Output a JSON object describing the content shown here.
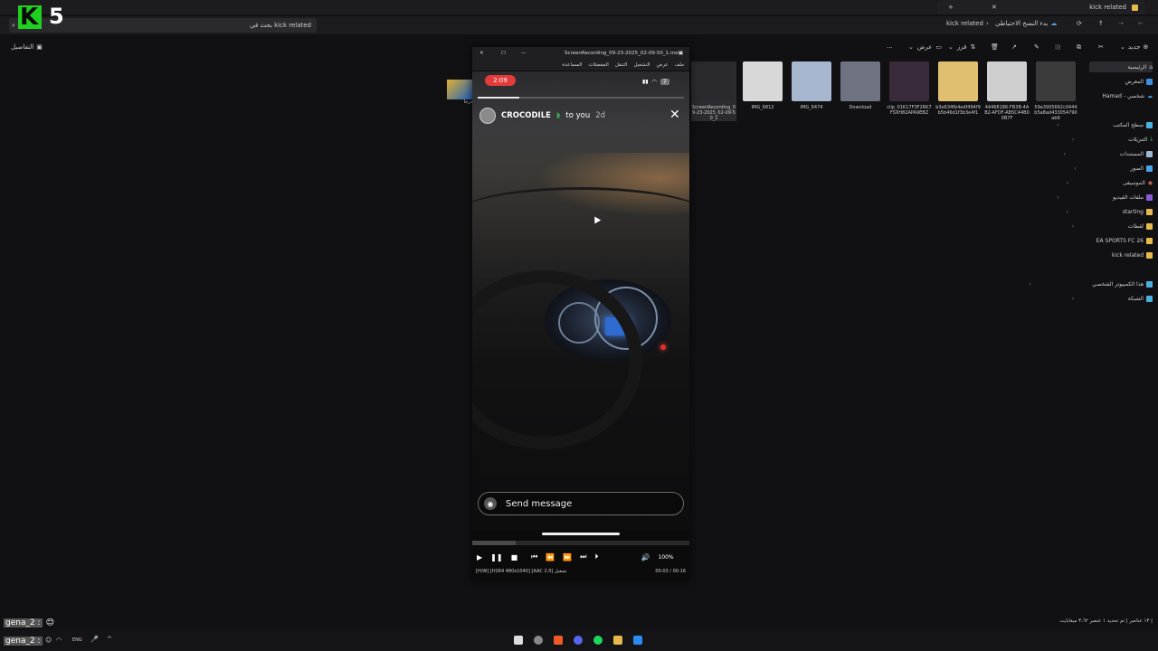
{
  "overlay": {
    "logo_letter": "K",
    "logo_number": "5"
  },
  "explorer": {
    "tab_title": "kick related",
    "breadcrumb": "kick related",
    "backup_label": "بدء النسخ الاحتياطي",
    "search_placeholder": "بحث في kick related",
    "details_label": "التفاصيل",
    "new_label": "جديد",
    "sort_label": "فرز",
    "view_label": "عرض",
    "more_label": "...",
    "nav": {
      "home": "الرئيسية",
      "gallery": "المعرض",
      "personal": "Hamad - شخصي",
      "desktop": "سطح المكتب",
      "downloads": "التنزيلات",
      "documents": "المستندات",
      "pictures": "الصور",
      "music": "الموسيقى",
      "videos": "ملفات الفيديو",
      "starting": "starting",
      "clips": "لقطات",
      "ea": "EA SPORTS FC 26",
      "kick": "kick related",
      "this_pc": "هذا الكمبيوتر الشخصي",
      "network": "الشبكة"
    },
    "files": [
      {
        "name": "ScreenRecording_09-23-2025_02-09-50_1",
        "color": "#2a2a2e"
      },
      {
        "name": "IMG_6812",
        "color": "#d8d8d8"
      },
      {
        "name": "IMG_6474",
        "color": "#a7b7d0"
      },
      {
        "name": "Download",
        "color": "#6f7280"
      },
      {
        "name": "clip_01K17F3F2RK7FSXH82APA9EBZ",
        "color": "#3a2b3b"
      },
      {
        "name": "b3e634fb4edf494f9b5b46d1f3b3e4f1",
        "color": "#e0c070"
      },
      {
        "name": "44468186-FB3B-4AB2-AFDF-AB5C44B00B7F",
        "color": "#cfcfcf"
      },
      {
        "name": "59a3905662c0444b5a8ad433054790ab9",
        "color": "#3b3b3b"
      }
    ],
    "partial_file": "درجا",
    "status": "١٣ عناصر  |  تم تحديد ١ عنصر ٣،٦٢ ميغابايت  |"
  },
  "player": {
    "title": "ScreenRecording_09-23-2025_02-09-50_1.mov",
    "menu": [
      "ملف",
      "عرض",
      "التشغيل",
      "التنقل",
      "المفضلات",
      "المساعدة"
    ],
    "story": {
      "time": "2:09",
      "battery": "7",
      "username": "CROCODILE",
      "to_you": "to you",
      "age": "2d",
      "send_placeholder": "Send message",
      "progress": 0.2
    },
    "seek_progress": 0.2,
    "volume": "100%",
    "codec_hw": "[H/W]",
    "codec_video": "[H264 480x1040]",
    "codec_audio": "[AAC 2.0] تشغيل",
    "time_display": "00:03 / 00:16"
  },
  "chat": {
    "user": "gena_2 :",
    "user2": "gena_2 :"
  },
  "taskbar": {
    "lang": "ENG"
  }
}
